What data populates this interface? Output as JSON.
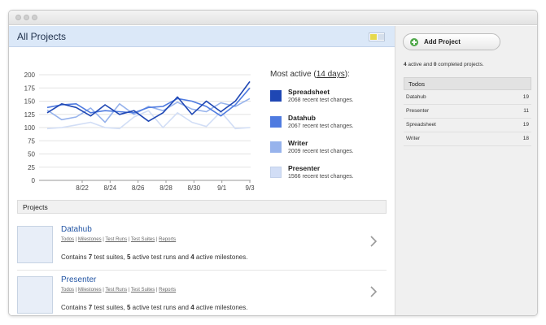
{
  "header": {
    "title": "All Projects"
  },
  "chart_data": {
    "type": "line",
    "x_ticks": [
      "8/22",
      "8/24",
      "8/26",
      "8/28",
      "8/30",
      "9/1",
      "9/3"
    ],
    "y_ticks": [
      0,
      25,
      50,
      75,
      100,
      125,
      150,
      175,
      200
    ],
    "ylim": [
      0,
      200
    ],
    "grid": true,
    "series": [
      {
        "name": "Spreadsheet",
        "color": "#1f47b4",
        "values": [
          128,
          145,
          138,
          122,
          143,
          125,
          132,
          112,
          128,
          158,
          125,
          150,
          130,
          150,
          187
        ]
      },
      {
        "name": "Datahub",
        "color": "#4f7be0",
        "values": [
          138,
          143,
          145,
          128,
          132,
          130,
          128,
          138,
          140,
          155,
          150,
          140,
          122,
          143,
          175
        ]
      },
      {
        "name": "Writer",
        "color": "#97b3ec",
        "values": [
          133,
          115,
          120,
          137,
          110,
          145,
          125,
          140,
          132,
          148,
          135,
          130,
          147,
          140,
          155
        ]
      },
      {
        "name": "Presenter",
        "color": "#d2def6",
        "values": [
          98,
          100,
          105,
          110,
          100,
          98,
          120,
          132,
          100,
          128,
          110,
          102,
          130,
          98,
          100
        ]
      }
    ]
  },
  "legend": {
    "title_prefix": "Most active (",
    "title_link": "14 days",
    "title_suffix": "):",
    "items": [
      {
        "name": "Spreadsheet",
        "sub": "2068 recent test changes.",
        "color": "#1f47b4"
      },
      {
        "name": "Datahub",
        "sub": "2067 recent test changes.",
        "color": "#4f7be0"
      },
      {
        "name": "Writer",
        "sub": "2009 recent test changes.",
        "color": "#97b3ec"
      },
      {
        "name": "Presenter",
        "sub": "1566 recent test changes.",
        "color": "#d2def6"
      }
    ]
  },
  "projects_section": {
    "title": "Projects"
  },
  "projects": [
    {
      "name": "Datahub",
      "links": [
        "Todos",
        "Milestones",
        "Test Runs",
        "Test Suites",
        "Reports"
      ],
      "desc_a": "Contains ",
      "suites": "7",
      "desc_b": " test suites, ",
      "runs": "5",
      "desc_c": " active test runs and ",
      "milestones": "4",
      "desc_d": " active milestones."
    },
    {
      "name": "Presenter",
      "links": [
        "Todos",
        "Milestones",
        "Test Runs",
        "Test Suites",
        "Reports"
      ],
      "desc_a": "Contains ",
      "suites": "7",
      "desc_b": " test suites, ",
      "runs": "5",
      "desc_c": " active test runs and ",
      "milestones": "4",
      "desc_d": " active milestones."
    }
  ],
  "link_separator": "|",
  "sidebar": {
    "add_label": "Add Project",
    "summary": {
      "active": "4",
      "mid": " active and ",
      "completed": "0",
      "end": " completed projects."
    },
    "todos_title": "Todos",
    "todos": [
      {
        "name": "Datahub",
        "count": "19"
      },
      {
        "name": "Presenter",
        "count": "11"
      },
      {
        "name": "Spreadsheet",
        "count": "19"
      },
      {
        "name": "Writer",
        "count": "18"
      }
    ]
  }
}
